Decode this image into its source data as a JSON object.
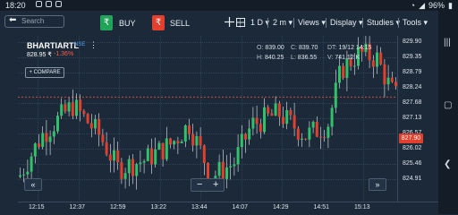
{
  "status": {
    "time": "18:20",
    "battery": "96%"
  },
  "toolbar": {
    "search_placeholder": "Search",
    "buy_label": "BUY",
    "sell_label": "SELL",
    "buy_symbol": "₹",
    "sell_symbol": "₹",
    "crosshair": "+",
    "interval": "1 D",
    "interval2": "2 m",
    "views": "Views",
    "display": "Display",
    "studies": "Studies",
    "tools": "Tools"
  },
  "symbol": {
    "name": "BHARTIARTL",
    "exchange": "NSE",
    "price": "828.95 ₹",
    "change": "-1.36%",
    "compare_label": "+ COMPARE"
  },
  "ohlc": {
    "o_label": "O:",
    "o": "839.00",
    "c_label": "C:",
    "c": "839.70",
    "dt_label": "DT:",
    "dt": "19/12 14:15",
    "h_label": "H:",
    "h": "840.25",
    "l_label": "L:",
    "l": "836.55",
    "v_label": "V:",
    "v": "741.12 K"
  },
  "y_axis": [
    "829.90",
    "829.35",
    "828.79",
    "828.24",
    "827.68",
    "827.13",
    "826.57",
    "826.02",
    "825.46",
    "824.91"
  ],
  "last_price": "827.90",
  "x_axis": [
    "12:15",
    "12:37",
    "12:59",
    "13:22",
    "13:44",
    "14:07",
    "14:29",
    "14:51",
    "15:13"
  ],
  "colors": {
    "up": "#2fc26a",
    "down": "#e2402f",
    "background": "#1c2938",
    "grid": "#2f4154"
  },
  "chart_data": {
    "type": "candlestick",
    "ylim": [
      824.6,
      830.2
    ],
    "x": [
      "12:15",
      "12:37",
      "12:59",
      "13:22",
      "13:44",
      "14:07",
      "14:29",
      "14:51",
      "15:13"
    ],
    "last_price": 827.9
  }
}
